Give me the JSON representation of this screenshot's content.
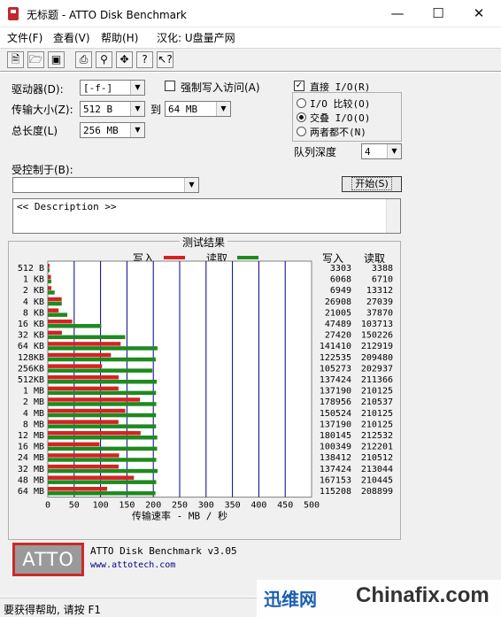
{
  "window": {
    "title": "无标题 - ATTO Disk Benchmark"
  },
  "menu": [
    "文件(F)",
    "查看(V)",
    "帮助(H)",
    "汉化: U盘量产网"
  ],
  "toolbar_icons": [
    "new-icon",
    "open-icon",
    "save-icon",
    "print-icon",
    "print-preview-icon",
    "move-icon",
    "help-icon",
    "context-help-icon"
  ],
  "settings": {
    "drive_label": "驱动器(D):",
    "drive_value": "[-f-]",
    "force_write_label": "强制写入访问(A)",
    "direct_io_label": "直接 I/O(R)",
    "transfer_label": "传输大小(Z):",
    "transfer_from": "512 B",
    "to_label": "到",
    "transfer_to": "64 MB",
    "total_length_label": "总长度(L)",
    "total_length_value": "256 MB",
    "io_compare_label": "I/O 比较(O)",
    "overlapped_io_label": "交叠 I/O(O)",
    "neither_label": "两者都不(N)",
    "queue_depth_label": "队列深度",
    "queue_depth_value": "4",
    "controlled_by_label": "受控制于(B):",
    "controlled_by_value": "",
    "start_label": "开始(S)",
    "description": "<< Description >>"
  },
  "results": {
    "title": "测试结果",
    "write_legend": "写入",
    "read_legend": "读取",
    "write_col": "写入",
    "read_col": "读取",
    "x_axis_label": "传输速率 - MB / 秒"
  },
  "colors": {
    "write": "#d42323",
    "read": "#1f8a1f",
    "grid": "#00008b"
  },
  "chart_data": {
    "type": "bar",
    "orientation": "horizontal",
    "categories": [
      "512 B",
      "1 KB",
      "2 KB",
      "4 KB",
      "8 KB",
      "16 KB",
      "32 KB",
      "64 KB",
      "128KB",
      "256KB",
      "512KB",
      "1 MB",
      "2 MB",
      "4 MB",
      "8 MB",
      "12 MB",
      "16 MB",
      "24 MB",
      "32 MB",
      "48 MB",
      "64 MB"
    ],
    "series": [
      {
        "name": "写入",
        "values": [
          3303,
          6068,
          6949,
          26908,
          21005,
          47489,
          27420,
          141410,
          122535,
          105273,
          137424,
          137190,
          178956,
          150524,
          137190,
          180145,
          100349,
          138412,
          137424,
          167153,
          115208
        ]
      },
      {
        "name": "读取",
        "values": [
          3388,
          6710,
          13312,
          27039,
          37870,
          103713,
          150226,
          212919,
          209480,
          202937,
          211366,
          210125,
          210537,
          210125,
          210125,
          212532,
          212201,
          210512,
          213044,
          210445,
          208899
        ]
      }
    ],
    "x_ticks": [
      0,
      50,
      100,
      150,
      200,
      250,
      300,
      350,
      400,
      450,
      500
    ],
    "xlim": [
      0,
      500
    ],
    "xlabel": "传输速率 - MB / 秒",
    "value_unit_note": "KB/s"
  },
  "footer": {
    "logo_text": "ATTO",
    "product": "ATTO Disk Benchmark v3.05",
    "url": "www.attotech.com"
  },
  "status": {
    "text": "要获得帮助, 请按 F1"
  },
  "watermark": {
    "brand_cn": "迅维网",
    "brand_en": "Chinafix.com"
  }
}
